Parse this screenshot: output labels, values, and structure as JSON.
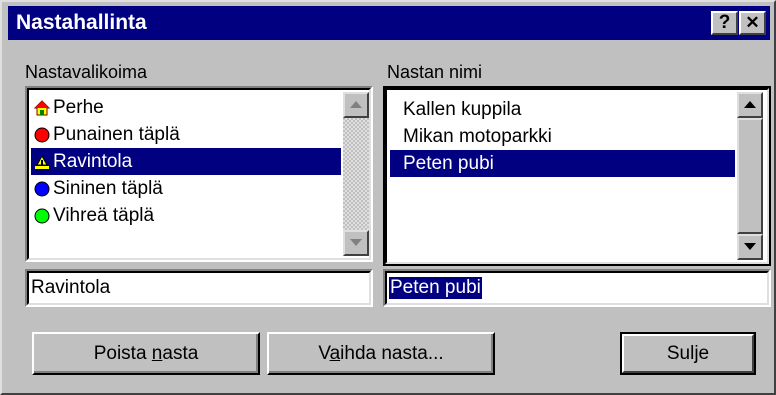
{
  "window": {
    "title": "Nastahallinta",
    "help_label": "?",
    "close_label": "✕"
  },
  "pin_library": {
    "label": "Nastavalikoima",
    "items": [
      {
        "label": "Perhe",
        "icon": "house-icon",
        "selected": false
      },
      {
        "label": "Punainen täplä",
        "icon": "red-dot-icon",
        "color": "#ff0000",
        "selected": false
      },
      {
        "label": "Ravintola",
        "icon": "restaurant-icon",
        "selected": true
      },
      {
        "label": "Sininen täplä",
        "icon": "blue-dot-icon",
        "color": "#0000ff",
        "selected": false
      },
      {
        "label": "Vihreä täplä",
        "icon": "green-dot-icon",
        "color": "#00ff00",
        "selected": false
      }
    ],
    "field_value": "Ravintola"
  },
  "pin_names": {
    "label": "Nastan nimi",
    "items": [
      {
        "label": "Kallen kuppila",
        "selected": false
      },
      {
        "label": "Mikan motoparkki",
        "selected": false
      },
      {
        "label": "Peten pubi",
        "selected": true
      }
    ],
    "field_value": "Peten pubi"
  },
  "buttons": {
    "delete_pre": "Poista ",
    "delete_accel": "n",
    "delete_post": "asta",
    "change_pre": "V",
    "change_accel": "a",
    "change_post": "ihda nasta...",
    "close": "Sulje"
  },
  "colors": {
    "titlebar": "#000080",
    "selection": "#000080",
    "face": "#c0c0c0"
  }
}
